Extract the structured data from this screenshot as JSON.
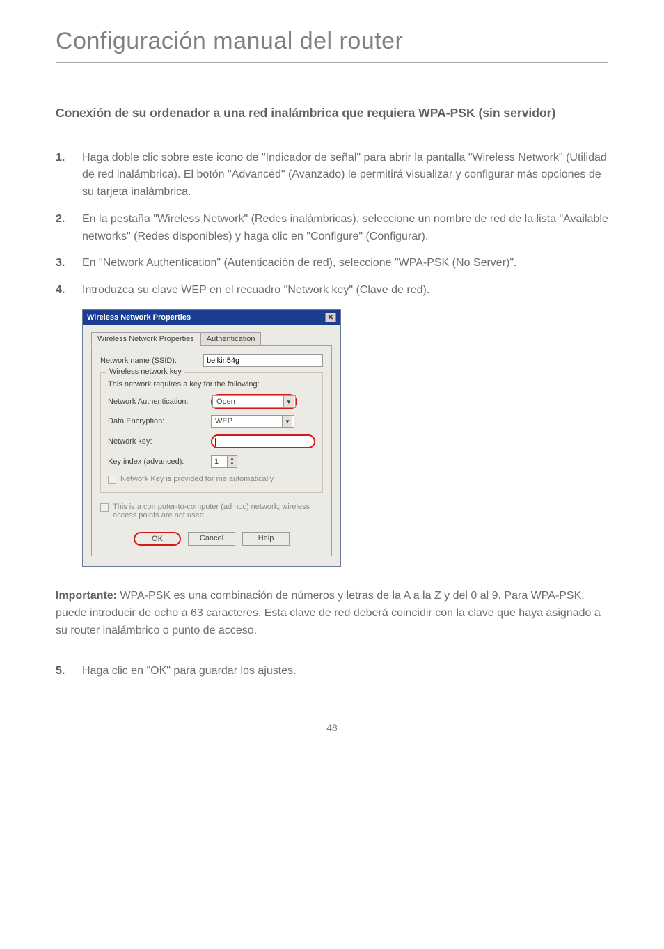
{
  "page_title": "Configuración manual del router",
  "section_heading": "Conexión de su ordenador a una red inalámbrica que requiera WPA-PSK (sin servidor)",
  "steps": [
    {
      "num": "1.",
      "text": "Haga doble clic sobre este icono de \"Indicador de señal\" para abrir la pantalla \"Wireless Network\" (Utilidad de red inalámbrica). El botón \"Advanced\" (Avanzado) le permitirá visualizar y configurar más opciones de su tarjeta inalámbrica."
    },
    {
      "num": "2.",
      "text": "En la pestaña \"Wireless Network\" (Redes inalámbricas), seleccione un nombre de red de la lista \"Available networks\" (Redes disponibles) y haga clic en \"Configure\" (Configurar)."
    },
    {
      "num": "3.",
      "text": "En \"Network Authentication\" (Autenticación de red), seleccione \"WPA-PSK (No Server)\"."
    },
    {
      "num": "4.",
      "text": "Introduzca su clave WEP en el recuadro \"Network key\" (Clave de red)."
    }
  ],
  "dialog": {
    "title": "Wireless Network Properties",
    "tab_active": "Wireless Network Properties",
    "tab_inactive": "Authentication",
    "network_name_label": "Network name (SSID):",
    "network_name_value": "belkin54g",
    "group_title": "Wireless network key",
    "group_sub": "This network requires a key for the following:",
    "auth_label": "Network Authentication:",
    "auth_value": "Open",
    "enc_label": "Data Encryption:",
    "enc_value": "WEP",
    "netkey_label": "Network key:",
    "keyindex_label": "Key index (advanced):",
    "keyindex_value": "1",
    "auto_key_label": "Network Key is provided for me automatically",
    "adhoc_label": "This is a computer-to-computer (ad hoc) network; wireless access points are not used",
    "btn_ok": "OK",
    "btn_cancel": "Cancel",
    "btn_help": "Help"
  },
  "important_label": "Importante:",
  "important_text": " WPA-PSK es una combinación de números y letras de la A a la Z y del 0 al 9. Para WPA-PSK, puede introducir de ocho a 63 caracteres. Esta clave de red deberá coincidir con la clave que haya asignado a su router inalámbrico o punto de acceso.",
  "step5_num": "5.",
  "step5_text": "Haga clic en \"OK\" para guardar los ajustes.",
  "page_number": "48"
}
